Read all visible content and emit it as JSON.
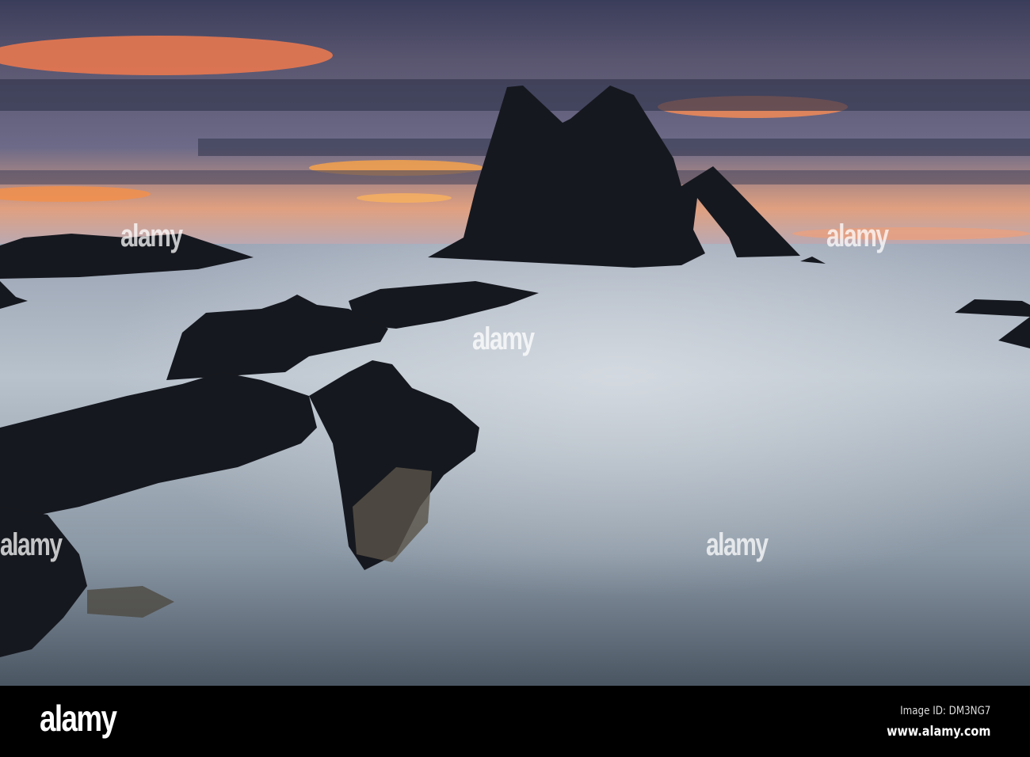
{
  "watermark": {
    "text": "alamy"
  },
  "footer": {
    "logo": "alamy",
    "image_id": "Image ID: DM3NG7",
    "url": "www.alamy.com"
  }
}
